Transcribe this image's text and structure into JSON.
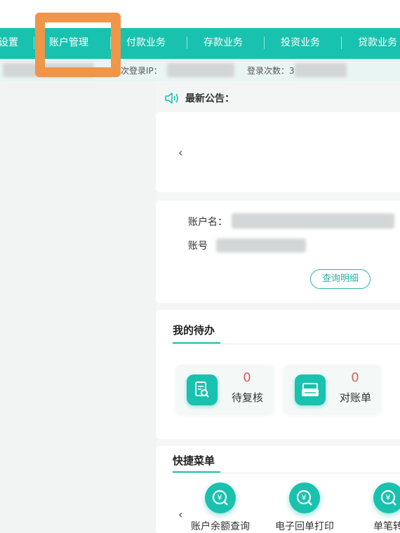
{
  "nav": {
    "items": [
      {
        "label": "设置"
      },
      {
        "label": "账户管理"
      },
      {
        "label": "付款业务"
      },
      {
        "label": "存款业务"
      },
      {
        "label": "投资业务"
      },
      {
        "label": "贷款业务"
      }
    ]
  },
  "info": {
    "last_login_ip_label": "次登录IP：",
    "login_count_label": "登录次数：3"
  },
  "notice": {
    "label": "最新公告："
  },
  "banner": {
    "prev": "‹"
  },
  "account": {
    "name_label": "账户名：",
    "number_label": "账号",
    "detail_button": "查询明细"
  },
  "todo": {
    "title": "我的待办",
    "items": [
      {
        "count": "0",
        "label": "待复核",
        "icon": "review-document-icon"
      },
      {
        "count": "0",
        "label": "对账单",
        "icon": "printer-icon"
      }
    ]
  },
  "quick": {
    "title": "快捷菜单",
    "prev": "‹",
    "items": [
      {
        "label": "账户余额查询",
        "icon": "yen-search-icon"
      },
      {
        "label": "电子回单打印",
        "icon": "yen-search-icon"
      },
      {
        "label": "单笔转",
        "icon": "yen-search-icon"
      }
    ]
  },
  "colors": {
    "accent": "#19c2ae",
    "highlight": "#f0964a",
    "count": "#e05a5a"
  }
}
